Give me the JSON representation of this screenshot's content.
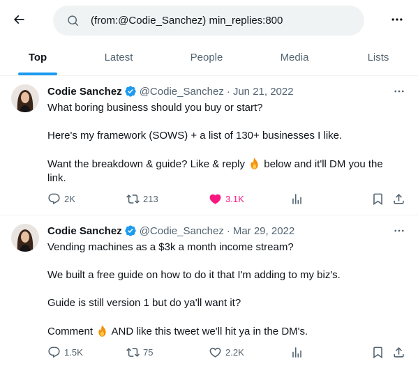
{
  "search": {
    "query": "(from:@Codie_Sanchez) min_replies:800"
  },
  "tabs": [
    {
      "label": "Top",
      "active": true
    },
    {
      "label": "Latest",
      "active": false
    },
    {
      "label": "People",
      "active": false
    },
    {
      "label": "Media",
      "active": false
    },
    {
      "label": "Lists",
      "active": false
    }
  ],
  "colors": {
    "accent": "#1d9bf0",
    "like": "#f91880",
    "secondary_text": "#536471",
    "search_bg": "#eff3f4"
  },
  "tweets": [
    {
      "author": "Codie Sanchez",
      "verified": true,
      "handle": "@Codie_Sanchez",
      "date": "Jun 21, 2022",
      "paragraphs": [
        "What boring business should you buy or start?",
        "Here's my framework (SOWS) + a list of 130+ businesses I like.",
        {
          "before": "Want the breakdown & guide? Like & reply ",
          "emoji": "fire-emoji",
          "after": " below and it'll DM you the link."
        }
      ],
      "replies": "2K",
      "retweets": "213",
      "likes": "3.1K",
      "liked": true
    },
    {
      "author": "Codie Sanchez",
      "verified": true,
      "handle": "@Codie_Sanchez",
      "date": "Mar 29, 2022",
      "paragraphs": [
        "Vending machines as a $3k a month income stream?",
        "We built a free guide on how to do it that I'm adding to my biz's.",
        "Guide is still version 1 but do ya'll want it?",
        {
          "before": "Comment ",
          "emoji": "fire-emoji",
          "after": " AND like this tweet we'll hit ya in the DM's."
        }
      ],
      "replies": "1.5K",
      "retweets": "75",
      "likes": "2.2K",
      "liked": false
    }
  ]
}
